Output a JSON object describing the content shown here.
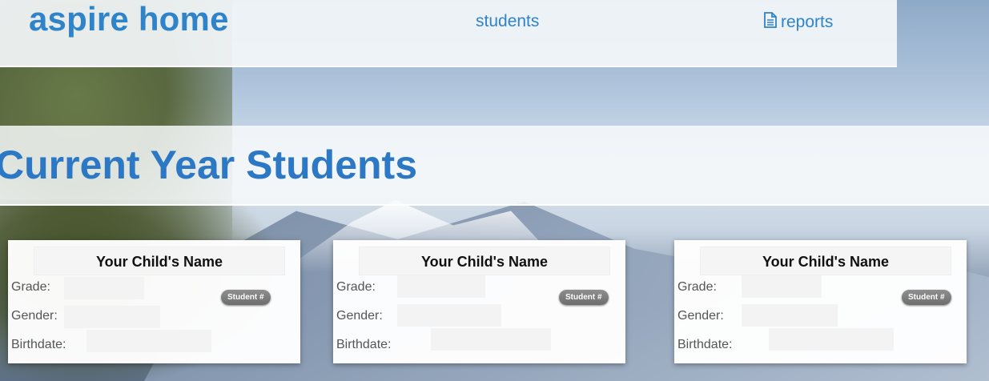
{
  "header": {
    "brand": "aspire home",
    "nav": {
      "students": "students",
      "reports": "reports"
    }
  },
  "page": {
    "title": "Current Year Students"
  },
  "cards": [
    {
      "name": "Your Child's Name",
      "grade_label": "Grade:",
      "gender_label": "Gender:",
      "birthdate_label": "Birthdate:",
      "badge": "Student #"
    },
    {
      "name": "Your Child's Name",
      "grade_label": "Grade:",
      "gender_label": "Gender:",
      "birthdate_label": "Birthdate:",
      "badge": "Student #"
    },
    {
      "name": "Your Child's Name",
      "grade_label": "Grade:",
      "gender_label": "Gender:",
      "birthdate_label": "Birthdate:",
      "badge": "Student #"
    }
  ],
  "icons": {
    "reports": "document-icon"
  },
  "colors": {
    "link": "#2f83c9",
    "title": "#2d78c4"
  }
}
